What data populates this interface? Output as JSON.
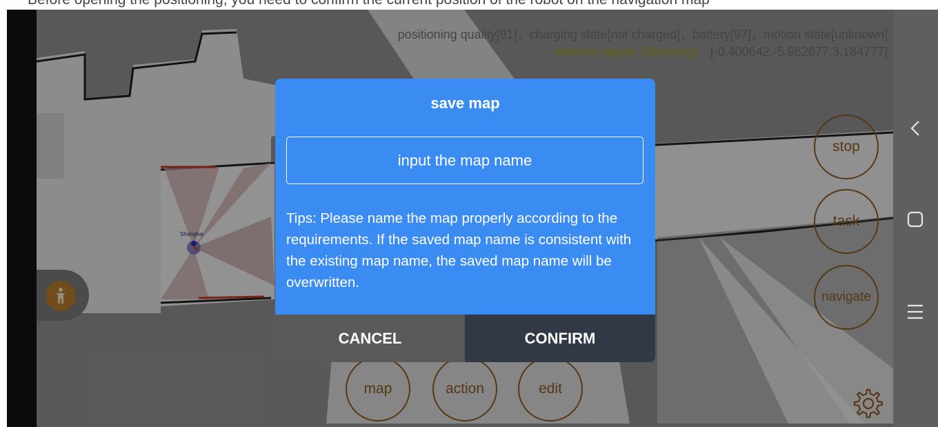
{
  "top_strip": {
    "text": "Before opening the positioning, you need to confirm the current position of the robot on the navigation map"
  },
  "status": {
    "line1": "positioning quality[91]，charging state[not charged]，battery[97]，motion state[unknown]",
    "network": "network signal:-50(strong)",
    "coords": "[-0.400642,-5.962677,3.184777]"
  },
  "map": {
    "robot_label": "Shanghai"
  },
  "side_buttons": {
    "stop": "stop",
    "task": "task",
    "navigate": "navigate"
  },
  "bottom_buttons": {
    "map": "map",
    "action": "action",
    "edit": "edit"
  },
  "dialog": {
    "title": "save map",
    "input_placeholder": "input the map name",
    "input_value": "",
    "tips": "Tips: Please name the map properly according to the requirements. If the saved map name is consistent with the existing map name, the saved map name will be overwritten.",
    "cancel": "CANCEL",
    "confirm": "CONFIRM"
  },
  "colors": {
    "dialog_bg": "#3a8cf2",
    "cancel_bg": "#5a5a5a",
    "confirm_bg": "#313846",
    "button_outline": "#8a5a23",
    "network_signal": "#9a9a1a"
  },
  "icons": {
    "back": "back-icon",
    "home": "home-icon",
    "menu": "menu-icon",
    "settings": "gear-icon",
    "person": "person-icon",
    "robot": "robot-marker-icon"
  }
}
